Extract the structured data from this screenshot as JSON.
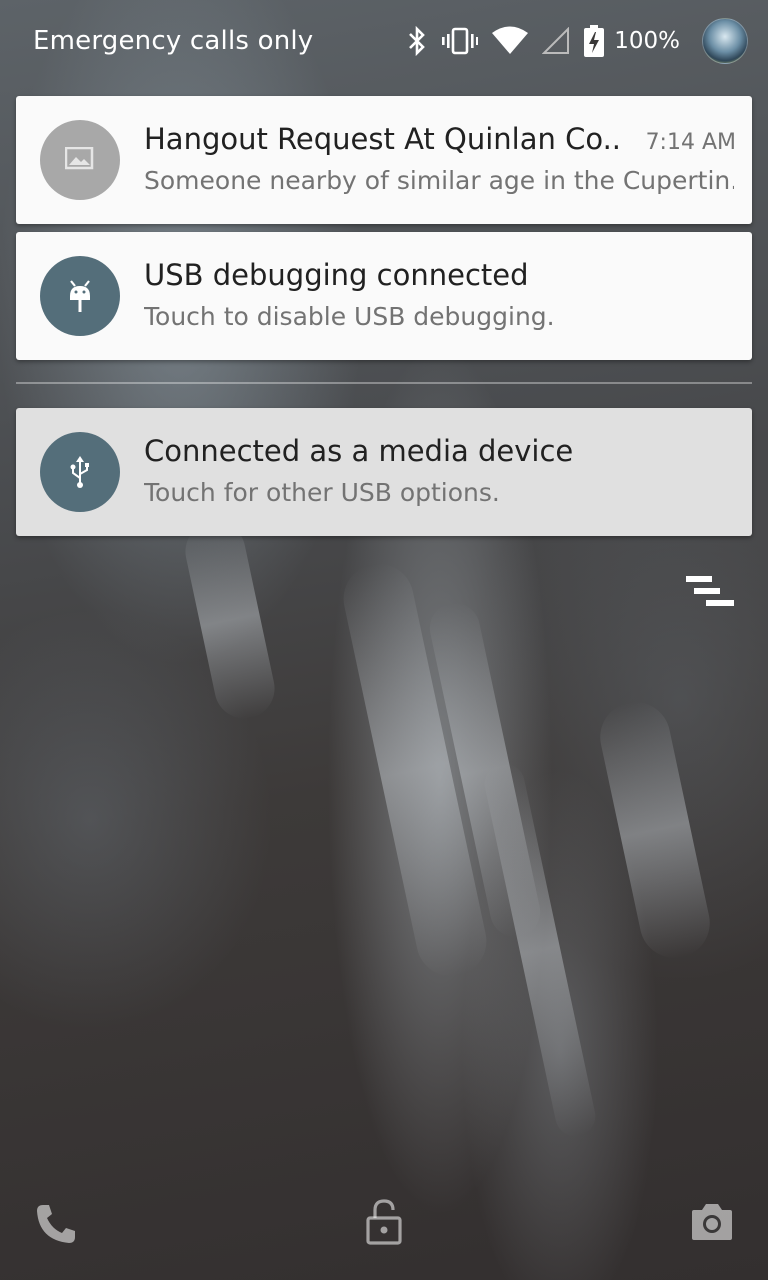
{
  "status_bar": {
    "carrier_text": "Emergency calls only",
    "battery_percent": "100%",
    "icons": [
      "bluetooth-icon",
      "vibrate-icon",
      "wifi-icon",
      "signal-icon",
      "battery-charging-icon",
      "avatar"
    ]
  },
  "notifications": [
    {
      "title": "Hangout Request At Quinlan Co..",
      "text": "Someone nearby of similar age in the Cupertin..",
      "time": "7:14 AM",
      "icon": "image-placeholder-icon",
      "icon_bg": "#9e9e9e"
    },
    {
      "title": "USB debugging connected",
      "text": "Touch to disable USB debugging.",
      "icon": "android-bug-icon",
      "icon_bg": "#546e7a"
    },
    {
      "title": "Connected as a media device",
      "text": "Touch for other USB options.",
      "icon": "usb-icon",
      "icon_bg": "#546e7a"
    }
  ],
  "bottom_bar": {
    "left_icon": "phone-icon",
    "center_icon": "lock-icon",
    "right_icon": "camera-icon"
  },
  "dismiss_all_icon": "clear-all-icon"
}
